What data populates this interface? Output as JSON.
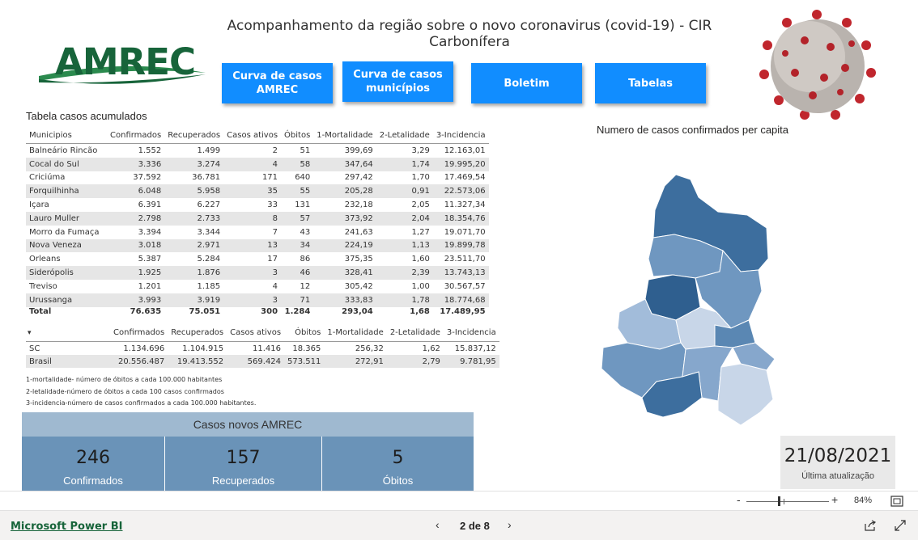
{
  "report": {
    "title": "Acompanhamento da região sobre o novo coronavirus (covid-19) - CIR Carbonífera"
  },
  "logo": {
    "text": "AMREC"
  },
  "nav_buttons": [
    {
      "label": "Curva de casos AMREC"
    },
    {
      "label": "Curva de casos municípios"
    },
    {
      "label": "Boletim"
    },
    {
      "label": "Tabelas"
    }
  ],
  "table_acumulados": {
    "title": "Tabela casos acumulados",
    "columns": [
      "Municipios",
      "Confirmados",
      "Recuperados",
      "Casos ativos",
      "Óbitos",
      "1-Mortalidade",
      "2-Letalidade",
      "3-Incidencia"
    ],
    "rows": [
      [
        "Balneário Rincão",
        "1.552",
        "1.499",
        "2",
        "51",
        "399,69",
        "3,29",
        "12.163,01"
      ],
      [
        "Cocal do Sul",
        "3.336",
        "3.274",
        "4",
        "58",
        "347,64",
        "1,74",
        "19.995,20"
      ],
      [
        "Criciúma",
        "37.592",
        "36.781",
        "171",
        "640",
        "297,42",
        "1,70",
        "17.469,54"
      ],
      [
        "Forquilhinha",
        "6.048",
        "5.958",
        "35",
        "55",
        "205,28",
        "0,91",
        "22.573,06"
      ],
      [
        "Içara",
        "6.391",
        "6.227",
        "33",
        "131",
        "232,18",
        "2,05",
        "11.327,34"
      ],
      [
        "Lauro Muller",
        "2.798",
        "2.733",
        "8",
        "57",
        "373,92",
        "2,04",
        "18.354,76"
      ],
      [
        "Morro da Fumaça",
        "3.394",
        "3.344",
        "7",
        "43",
        "241,63",
        "1,27",
        "19.071,70"
      ],
      [
        "Nova Veneza",
        "3.018",
        "2.971",
        "13",
        "34",
        "224,19",
        "1,13",
        "19.899,78"
      ],
      [
        "Orleans",
        "5.387",
        "5.284",
        "17",
        "86",
        "375,35",
        "1,60",
        "23.511,70"
      ],
      [
        "Siderópolis",
        "1.925",
        "1.876",
        "3",
        "46",
        "328,41",
        "2,39",
        "13.743,13"
      ],
      [
        "Treviso",
        "1.201",
        "1.185",
        "4",
        "12",
        "305,42",
        "1,00",
        "30.567,57"
      ],
      [
        "Urussanga",
        "3.993",
        "3.919",
        "3",
        "71",
        "333,83",
        "1,78",
        "18.774,68"
      ]
    ],
    "total": [
      "Total",
      "76.635",
      "75.051",
      "300",
      "1.284",
      "293,04",
      "1,68",
      "17.489,95"
    ]
  },
  "table_estado": {
    "columns": [
      "",
      "Confirmados",
      "Recuperados",
      "Casos ativos",
      "Óbitos",
      "1-Mortalidade",
      "2-Letalidade",
      "3-Incidencia"
    ],
    "rows": [
      [
        "SC",
        "1.134.696",
        "1.104.915",
        "11.416",
        "18.365",
        "256,32",
        "1,62",
        "15.837,12"
      ],
      [
        "Brasil",
        "20.556.487",
        "19.413.552",
        "569.424",
        "573.511",
        "272,91",
        "2,79",
        "9.781,95"
      ]
    ]
  },
  "notes": [
    "1-mortalidade- número de óbitos a cada 100.000 habitantes",
    "2-letalidade-número de óbitos a cada 100 casos confirmados",
    "3-incidencia-número de casos confirmados a cada 100.000 habitantes."
  ],
  "casos_novos": {
    "header": "Casos novos AMREC",
    "cards": [
      {
        "value": "246",
        "label": "Confirmados"
      },
      {
        "value": "157",
        "label": "Recuperados"
      },
      {
        "value": "5",
        "label": "Óbitos"
      }
    ]
  },
  "map": {
    "title": "Numero de casos confirmados per capita",
    "colors": [
      "#2f5f8f",
      "#3d6e9e",
      "#5a87b3",
      "#6f97c0",
      "#86a7cc",
      "#a2bcda",
      "#c8d6e8"
    ]
  },
  "update": {
    "date": "21/08/2021",
    "label": "Última atualização"
  },
  "zoom": {
    "minus": "-",
    "plus": "+",
    "value": "84%",
    "level": 0.84
  },
  "footer": {
    "link": "Microsoft Power BI",
    "page_indicator": "2 de 8",
    "prev": "‹",
    "next": "›"
  }
}
